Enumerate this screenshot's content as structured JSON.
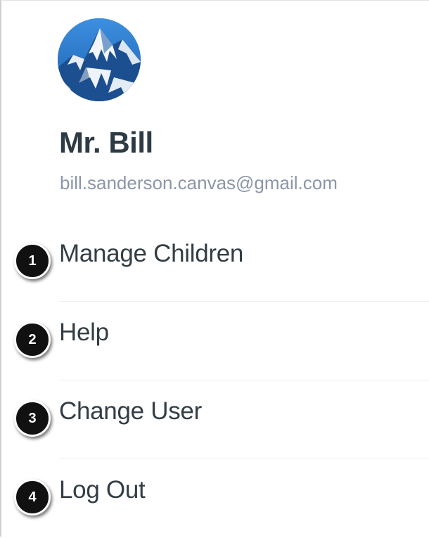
{
  "profile": {
    "name": "Mr. Bill",
    "email": "bill.sanderson.canvas@gmail.com",
    "avatar_icon": "mountain-avatar"
  },
  "menu": {
    "items": [
      {
        "label": "Manage Children",
        "callout": "1"
      },
      {
        "label": "Help",
        "callout": "2"
      },
      {
        "label": "Change User",
        "callout": "3"
      },
      {
        "label": "Log Out",
        "callout": "4"
      }
    ]
  },
  "colors": {
    "name_text": "#2d3b45",
    "email_text": "#8b96a8",
    "menu_text": "#333d44",
    "callout_bg": "#111111"
  }
}
